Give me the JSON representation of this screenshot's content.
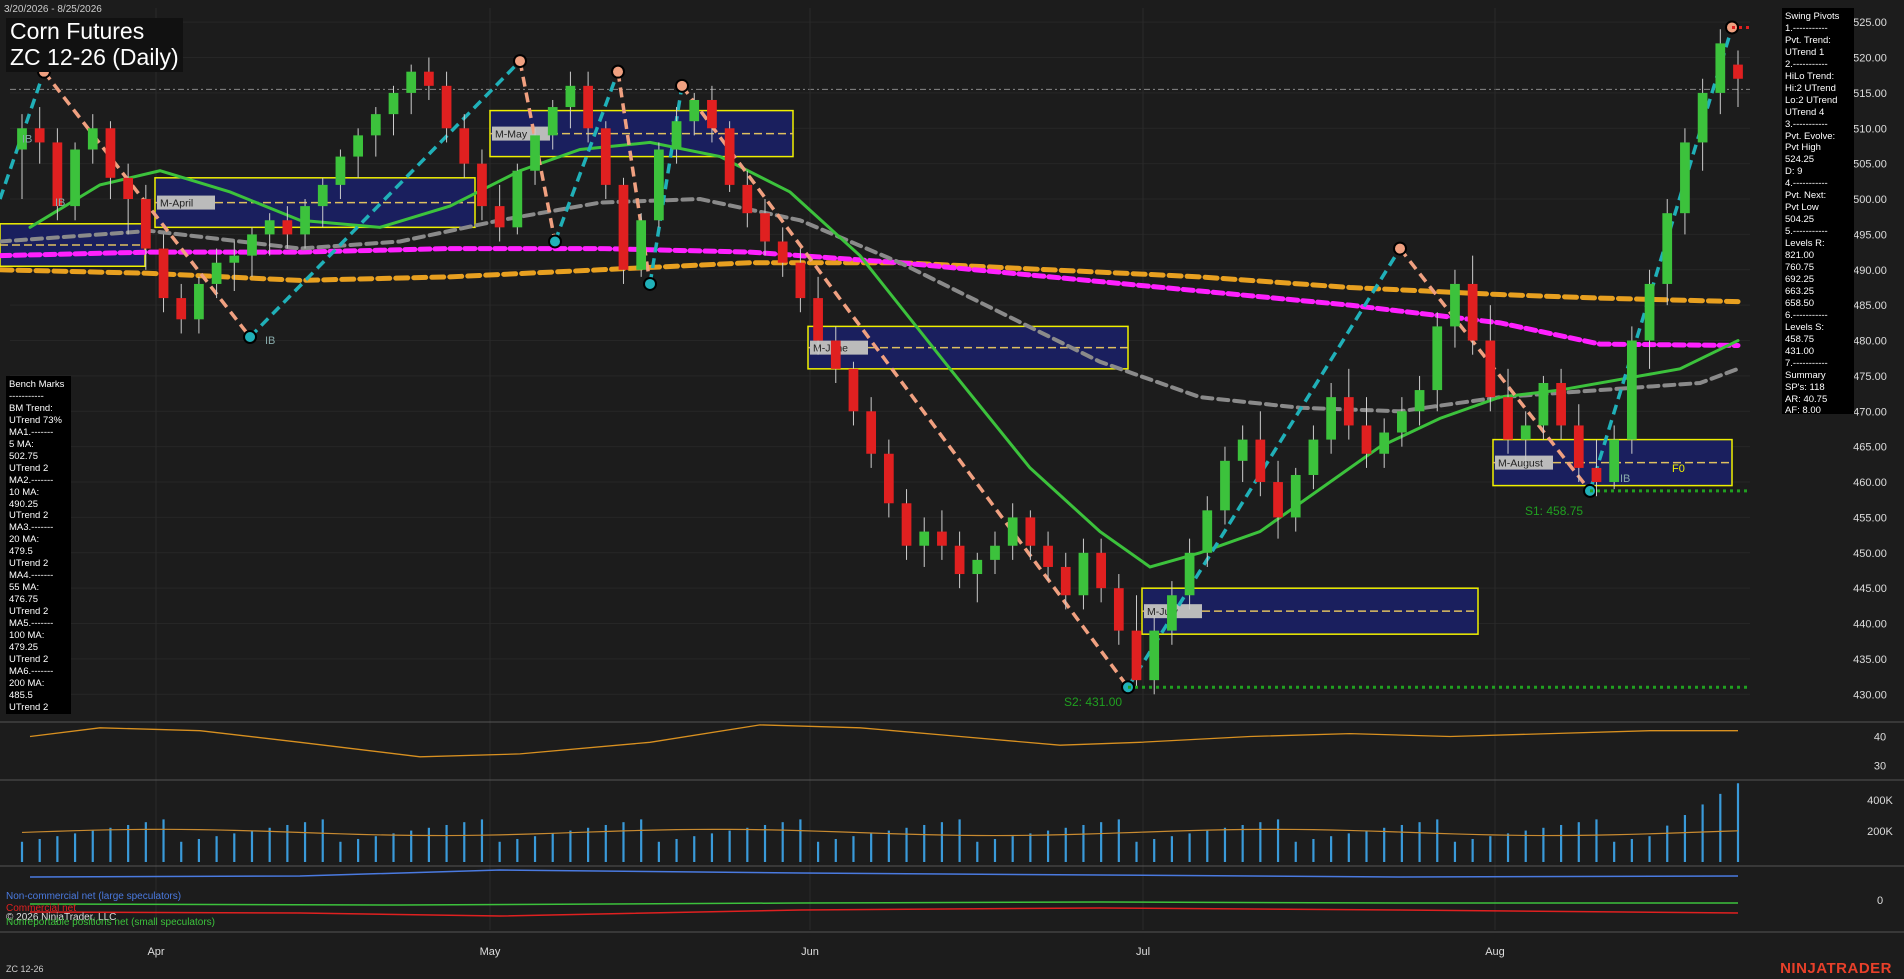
{
  "header": {
    "date_range": "3/20/2026 - 8/25/2026",
    "title": "Corn Futures",
    "subtitle": "ZC 12-26 (Daily)"
  },
  "footer": {
    "symbol": "ZC 12-26",
    "copyright": "© 2026 NinjaTrader, LLC",
    "brand": "NINJATRADER"
  },
  "colors": {
    "background": "#1c1c1c",
    "up_candle": "#3cc23c",
    "down_candle": "#e02020",
    "ma_green": "#3cc23c",
    "ma_gray": "#8a8a8a",
    "ma_magenta": "#ff20ff",
    "ma_orange": "#e8a020",
    "swing_up": "#20b0b8",
    "swing_down": "#f0a080",
    "box_border": "#f0f000",
    "box_fill": "#1a1f5e",
    "volume": "#3a9ad9",
    "noncommercial": "#4a7ae0",
    "commercial": "#e02020",
    "small_spec": "#3cc23c"
  },
  "bench_marks": {
    "lines": [
      "Bench Marks",
      "-----------",
      "BM Trend:",
      "UTrend 73%",
      "MA1.-------",
      "5 MA:",
      "502.75",
      "UTrend 2",
      "MA2.-------",
      "10 MA:",
      "490.25",
      "UTrend 2",
      "MA3.-------",
      "20 MA:",
      "479.5",
      "UTrend 2",
      "MA4.-------",
      "55 MA:",
      "476.75",
      "UTrend 2",
      "MA5.-------",
      "100 MA:",
      "479.25",
      "UTrend 2",
      "MA6.-------",
      "200 MA:",
      "485.5",
      "UTrend 2"
    ]
  },
  "swing_pivots": {
    "lines": [
      "Swing Pivots",
      "1.-----------",
      "Pvt. Trend:",
      "UTrend 1",
      "2.-----------",
      "HiLo Trend:",
      "Hi:2 UTrend",
      "Lo:2 UTrend",
      "UTrend 4",
      "3.-----------",
      "Pvt. Evolve:",
      "Pvt High",
      "524.25",
      "D: 9",
      "4.-----------",
      "Pvt. Next:",
      "Pvt Low",
      "504.25",
      "5.-----------",
      "Levels R:",
      "821.00",
      "760.75",
      "692.25",
      "663.25",
      "658.50",
      "6.-----------",
      "Levels S:",
      "458.75",
      "431.00",
      "7.-----------",
      "Summary",
      "SP's: 118",
      "AR: 40.75",
      "AF: 8.00"
    ]
  },
  "annotations": {
    "s1_label": "S1: 458.75",
    "s2_label": "S2: 431.00",
    "ib_label": "IB",
    "f0_label": "F0",
    "month_boxes": [
      "M-April",
      "M-May",
      "M-June",
      "M-July",
      "M-August"
    ]
  },
  "indicator_legend": {
    "noncommercial": "Non-commercial net (large speculators)",
    "commercial": "Commercial net",
    "small_spec": "Nonreportable positions net (small speculators)"
  },
  "chart_data": {
    "type": "candlestick",
    "x_ticks": [
      "Apr",
      "May",
      "Jun",
      "Jul",
      "Aug"
    ],
    "y_ticks": [
      430,
      435,
      440,
      445,
      450,
      455,
      460,
      465,
      470,
      475,
      480,
      485,
      490,
      495,
      500,
      505,
      510,
      515,
      520,
      525
    ],
    "y_tick_labels": [
      "430.00",
      "435.00",
      "440.00",
      "445.00",
      "450.00",
      "455.00",
      "460.00",
      "465.00",
      "470.00",
      "475.00",
      "480.00",
      "485.00",
      "490.00",
      "495.00",
      "500.00",
      "505.00",
      "510.00",
      "515.00",
      "520.00",
      "525.00"
    ],
    "ylim": [
      427.5,
      527
    ],
    "osc_ticks": [
      30,
      40
    ],
    "volume_ticks": [
      "200K",
      "400K"
    ],
    "cot_ticks": [
      "0"
    ],
    "candles": [
      [
        507,
        512,
        500,
        510
      ],
      [
        510,
        513,
        505,
        508
      ],
      [
        508,
        510,
        497,
        499
      ],
      [
        499,
        508,
        497,
        507
      ],
      [
        507,
        512,
        505,
        510
      ],
      [
        510,
        511,
        500,
        503
      ],
      [
        503,
        505,
        495,
        500
      ],
      [
        500,
        502,
        490,
        493
      ],
      [
        493,
        495,
        484,
        486
      ],
      [
        486,
        488,
        481,
        483
      ],
      [
        483,
        489,
        481,
        488
      ],
      [
        488,
        493,
        486,
        491
      ],
      [
        491,
        494,
        487,
        492
      ],
      [
        492,
        496,
        489,
        495
      ],
      [
        495,
        498,
        492,
        497
      ],
      [
        497,
        499,
        493,
        495
      ],
      [
        495,
        500,
        493,
        499
      ],
      [
        499,
        503,
        496,
        502
      ],
      [
        502,
        507,
        500,
        506
      ],
      [
        506,
        510,
        503,
        509
      ],
      [
        509,
        513,
        506,
        512
      ],
      [
        512,
        516,
        509,
        515
      ],
      [
        515,
        519,
        512,
        518
      ],
      [
        518,
        520,
        514,
        516
      ],
      [
        516,
        518,
        508,
        510
      ],
      [
        510,
        512,
        503,
        505
      ],
      [
        505,
        507,
        497,
        499
      ],
      [
        499,
        502,
        494,
        496
      ],
      [
        496,
        505,
        495,
        504
      ],
      [
        504,
        510,
        502,
        509
      ],
      [
        509,
        514,
        507,
        513
      ],
      [
        513,
        518,
        510,
        516
      ],
      [
        516,
        518,
        508,
        510
      ],
      [
        510,
        511,
        500,
        502
      ],
      [
        502,
        503,
        488,
        490
      ],
      [
        490,
        498,
        489,
        497
      ],
      [
        497,
        508,
        496,
        507
      ],
      [
        507,
        513,
        505,
        511
      ],
      [
        511,
        515,
        509,
        514
      ],
      [
        514,
        516,
        508,
        510
      ],
      [
        510,
        511,
        501,
        502
      ],
      [
        502,
        504,
        496,
        498
      ],
      [
        498,
        500,
        492,
        494
      ],
      [
        494,
        496,
        489,
        491
      ],
      [
        491,
        493,
        484,
        486
      ],
      [
        486,
        489,
        478,
        480
      ],
      [
        480,
        482,
        474,
        476
      ],
      [
        476,
        477,
        468,
        470
      ],
      [
        470,
        472,
        462,
        464
      ],
      [
        464,
        466,
        455,
        457
      ],
      [
        457,
        459,
        449,
        451
      ],
      [
        451,
        455,
        448,
        453
      ],
      [
        453,
        456,
        449,
        451
      ],
      [
        451,
        453,
        445,
        447
      ],
      [
        447,
        450,
        443,
        449
      ],
      [
        449,
        453,
        447,
        451
      ],
      [
        451,
        457,
        449,
        455
      ],
      [
        455,
        456,
        449,
        451
      ],
      [
        451,
        453,
        446,
        448
      ],
      [
        448,
        450,
        442,
        444
      ],
      [
        444,
        452,
        442,
        450
      ],
      [
        450,
        452,
        443,
        445
      ],
      [
        445,
        447,
        437,
        439
      ],
      [
        439,
        444,
        431,
        432
      ],
      [
        432,
        441,
        430,
        439
      ],
      [
        439,
        446,
        437,
        444
      ],
      [
        444,
        452,
        442,
        450
      ],
      [
        450,
        458,
        448,
        456
      ],
      [
        456,
        465,
        454,
        463
      ],
      [
        463,
        468,
        460,
        466
      ],
      [
        466,
        470,
        458,
        460
      ],
      [
        460,
        463,
        452,
        455
      ],
      [
        455,
        462,
        453,
        461
      ],
      [
        461,
        468,
        459,
        466
      ],
      [
        466,
        474,
        464,
        472
      ],
      [
        472,
        476,
        466,
        468
      ],
      [
        468,
        472,
        462,
        464
      ],
      [
        464,
        469,
        462,
        467
      ],
      [
        467,
        472,
        465,
        470
      ],
      [
        470,
        475,
        468,
        473
      ],
      [
        473,
        484,
        470,
        482
      ],
      [
        482,
        490,
        479,
        488
      ],
      [
        488,
        492,
        478,
        480
      ],
      [
        480,
        485,
        470,
        472
      ],
      [
        472,
        476,
        464,
        466
      ],
      [
        466,
        470,
        462,
        468
      ],
      [
        468,
        475,
        466,
        474
      ],
      [
        474,
        476,
        466,
        468
      ],
      [
        468,
        471,
        460,
        462
      ],
      [
        462,
        466,
        458,
        460
      ],
      [
        460,
        468,
        459,
        466
      ],
      [
        466,
        482,
        464,
        480
      ],
      [
        480,
        490,
        476,
        488
      ],
      [
        488,
        500,
        485,
        498
      ],
      [
        498,
        510,
        495,
        508
      ],
      [
        508,
        517,
        504,
        515
      ],
      [
        515,
        524,
        512,
        522
      ],
      [
        519,
        521,
        513,
        517
      ]
    ]
  }
}
